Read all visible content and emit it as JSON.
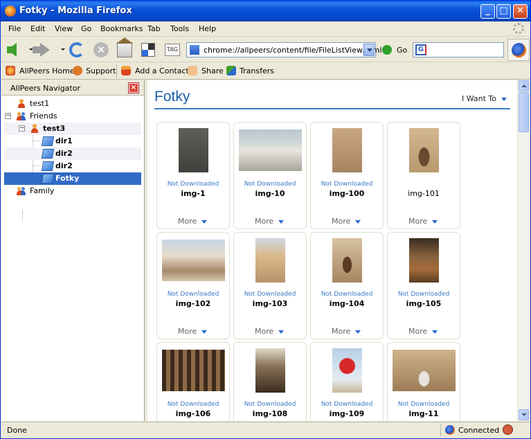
{
  "window": {
    "title": "Fotky - Mozilla Firefox"
  },
  "menu": [
    "File",
    "Edit",
    "View",
    "Go",
    "Bookmarks",
    "Tab",
    "Tools",
    "Help"
  ],
  "navbar": {
    "url": "chrome://allpeers/content/file/FileListView.html",
    "go_label": "Go",
    "tag_label": "TAG"
  },
  "peers_toolbar": {
    "home": "AllPeers Home",
    "support": "Support",
    "add_contact": "Add a Contact",
    "share": "Share",
    "transfers": "Transfers"
  },
  "sidebar": {
    "title": "AllPeers Navigator",
    "tree": {
      "test1": "test1",
      "friends": "Friends",
      "test3": "test3",
      "dir1": "dir1",
      "dir2a": "dir2",
      "dir2b": "dir2",
      "fotky": "Fotky",
      "family": "Family"
    }
  },
  "content": {
    "title": "Fotky",
    "i_want_to": "I Want To",
    "more_label": "More",
    "not_downloaded": "Not Downloaded",
    "items": [
      {
        "name": "img-1",
        "status": "Not Downloaded"
      },
      {
        "name": "img-10",
        "status": "Not Downloaded"
      },
      {
        "name": "img-100",
        "status": "Not Downloaded"
      },
      {
        "name": "img-101",
        "status": ""
      },
      {
        "name": "img-102",
        "status": "Not Downloaded"
      },
      {
        "name": "img-103",
        "status": "Not Downloaded"
      },
      {
        "name": "img-104",
        "status": "Not Downloaded"
      },
      {
        "name": "img-105",
        "status": "Not Downloaded"
      },
      {
        "name": "img-106",
        "status": "Not Downloaded"
      },
      {
        "name": "img-108",
        "status": "Not Downloaded"
      },
      {
        "name": "img-109",
        "status": "Not Downloaded"
      },
      {
        "name": "img-11",
        "status": "Not Downloaded"
      }
    ]
  },
  "status": {
    "left": "Done",
    "connection": "Connected"
  }
}
